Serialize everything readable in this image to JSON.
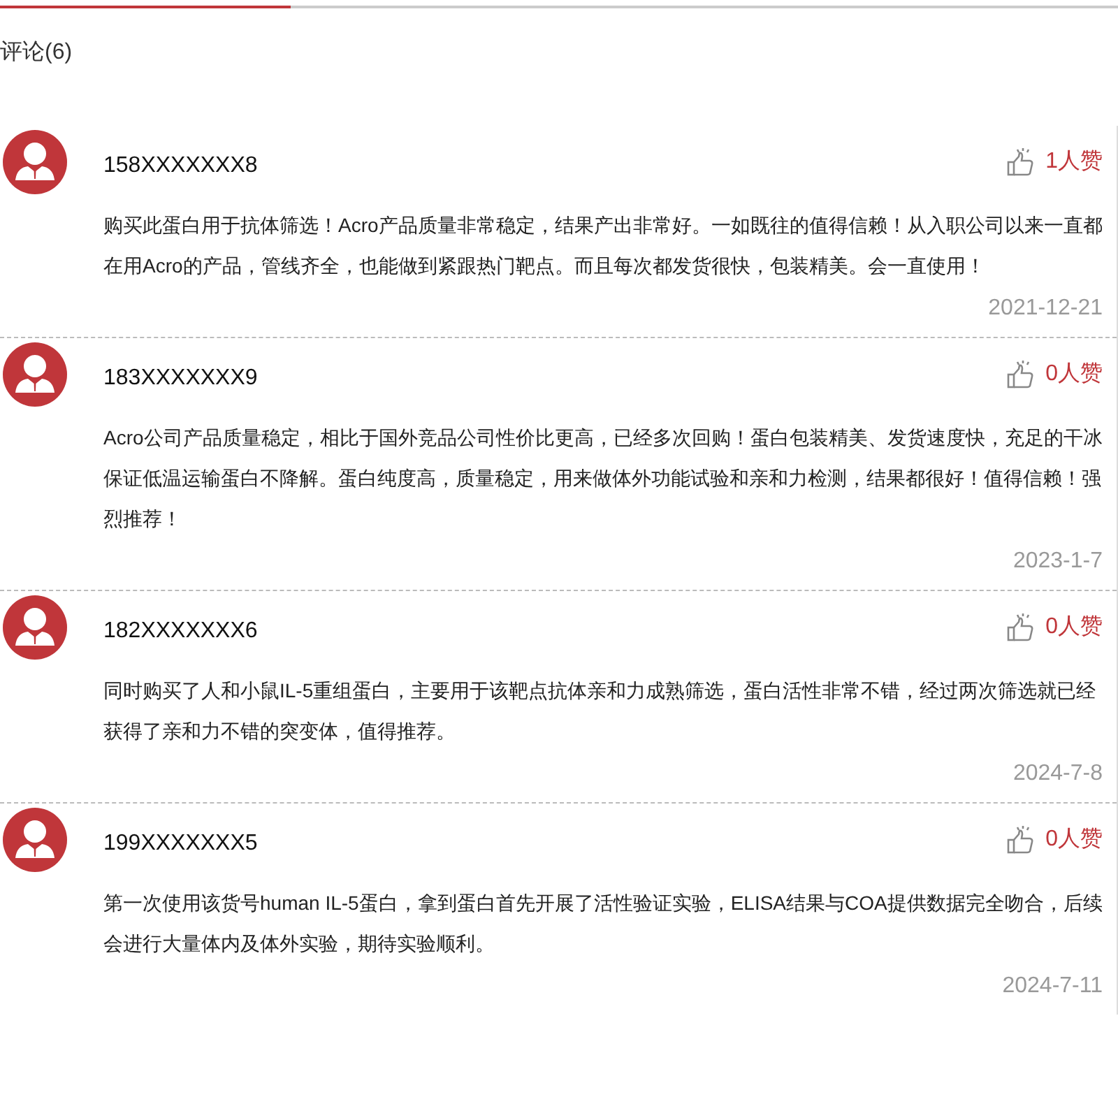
{
  "tabs_underline": {
    "selected": true
  },
  "section_title": "评论(6)",
  "comments": [
    {
      "user": "158XXXXXXX8",
      "likes": "1人赞",
      "text": "购买此蛋白用于抗体筛选！Acro产品质量非常稳定，结果产出非常好。一如既往的值得信赖！从入职公司以来一直都在用Acro的产品，管线齐全，也能做到紧跟热门靶点。而且每次都发货很快，包装精美。会一直使用！",
      "date": "2021-12-21"
    },
    {
      "user": "183XXXXXXX9",
      "likes": "0人赞",
      "text": "Acro公司产品质量稳定，相比于国外竞品公司性价比更高，已经多次回购！蛋白包装精美、发货速度快，充足的干冰保证低温运输蛋白不降解。蛋白纯度高，质量稳定，用来做体外功能试验和亲和力检测，结果都很好！值得信赖！强烈推荐！",
      "date": "2023-1-7"
    },
    {
      "user": "182XXXXXXX6",
      "likes": "0人赞",
      "text": "同时购买了人和小鼠IL-5重组蛋白，主要用于该靶点抗体亲和力成熟筛选，蛋白活性非常不错，经过两次筛选就已经获得了亲和力不错的突变体，值得推荐。",
      "date": "2024-7-8"
    },
    {
      "user": "199XXXXXXX5",
      "likes": "0人赞",
      "text": "第一次使用该货号human IL-5蛋白，拿到蛋白首先开展了活性验证实验，ELISA结果与COA提供数据完全吻合，后续会进行大量体内及体外实验，期待实验顺利。",
      "date": "2024-7-11"
    }
  ]
}
